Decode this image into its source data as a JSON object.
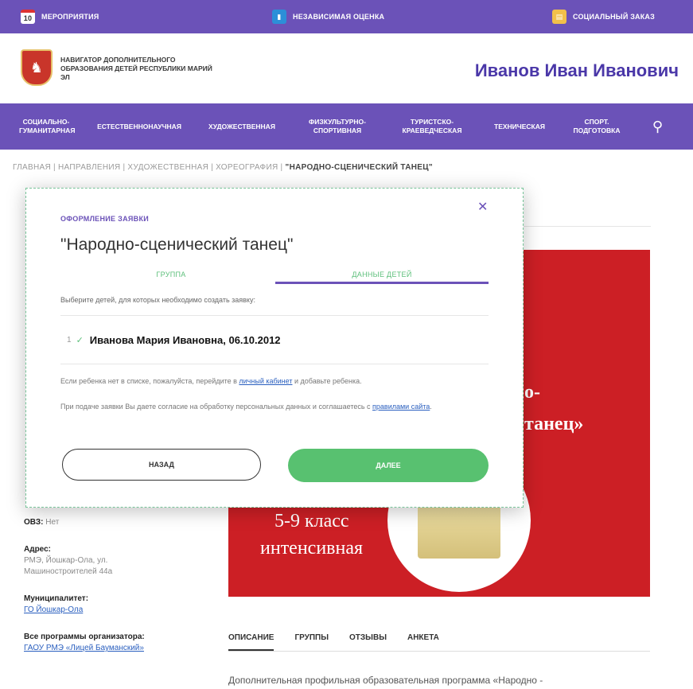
{
  "topbar": {
    "calendar_day": "10",
    "events": "МЕРОПРИЯТИЯ",
    "assessment": "НЕЗАВИСИМАЯ ОЦЕНКА",
    "order": "СОЦИАЛЬНЫЙ ЗАКАЗ"
  },
  "header": {
    "site_title": "НАВИГАТОР ДОПОЛНИТЕЛЬНОГО ОБРАЗОВАНИЯ ДЕТЕЙ РЕСПУБЛИКИ МАРИЙ ЭЛ",
    "user_name": "Иванов Иван Иванович"
  },
  "nav": {
    "items": [
      "СОЦИАЛЬНО-ГУМАНИТАРНАЯ",
      "ЕСТЕСТВЕННОНАУЧНАЯ",
      "ХУДОЖЕСТВЕННАЯ",
      "ФИЗКУЛЬТУРНО-СПОРТИВНАЯ",
      "ТУРИСТСКО-КРАЕВЕДЧЕСКАЯ",
      "ТЕХНИЧЕСКАЯ",
      "СПОРТ. ПОДГОТОВКА"
    ]
  },
  "breadcrumb": {
    "path": "ГЛАВНАЯ | НАПРАВЛЕНИЯ | ХУДОЖЕСТВЕННАЯ | ХОРЕОГРАФИЯ | ",
    "current": "\"НАРОДНО-СЦЕНИЧЕСКИЙ ТАНЕЦ\""
  },
  "modal": {
    "label": "ОФОРМЛЕНИЕ ЗАЯВКИ",
    "title": "\"Народно-сценический танец\"",
    "tab_group": "ГРУППА",
    "tab_children": "ДАННЫЕ ДЕТЕЙ",
    "instruction": "Выберите детей, для которых необходимо создать заявку:",
    "child_num": "1",
    "child": "Иванова Мария Ивановна, 06.10.2012",
    "note1_a": "Если ребенка нет в списке, пожалуйста, перейдите в ",
    "note1_link": "личный кабинет",
    "note1_b": " и добавьте ребенка.",
    "note2_a": "При подаче заявки Вы даете согласие на обработку персональных данных и соглашаетесь с ",
    "note2_link": "правилами сайта",
    "note2_b": ".",
    "back": "НАЗАД",
    "next": "ДАЛЕЕ",
    "close": "✕"
  },
  "left": {
    "ovz_label": "ОВЗ:",
    "ovz_value": "Нет",
    "address_label": "Адрес:",
    "address_value": "РМЭ, Йошкар-Ола, ул. Машиностроителей 44а",
    "muni_label": "Муниципалитет:",
    "muni_value": "ГО Йошкар-Ола",
    "org_label": "Все программы организатора:",
    "org_value": "ГАОУ РМЭ «Лицей Бауманский»"
  },
  "poster": {
    "t1": "о-",
    "t2": "танец»",
    "t3": "5-9 класс",
    "t4": "интенсивная"
  },
  "content_tabs": [
    "ОПИСАНИЕ",
    "ГРУППЫ",
    "ОТЗЫВЫ",
    "АНКЕТА"
  ],
  "description": "Дополнительная профильная образовательная программа «Народно -"
}
